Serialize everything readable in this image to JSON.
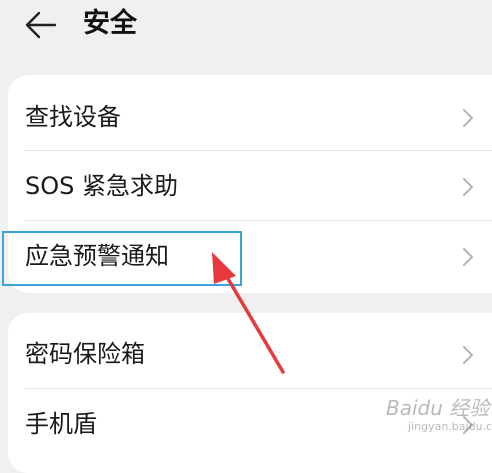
{
  "header": {
    "back_icon": "arrow-left-icon",
    "title": "安全"
  },
  "groups": [
    {
      "items": [
        {
          "label": "查找设备",
          "icon": "chevron-right-icon"
        },
        {
          "label": "SOS 紧急求助",
          "icon": "chevron-right-icon"
        },
        {
          "label": "应急预警通知",
          "icon": "chevron-right-icon"
        }
      ]
    },
    {
      "items": [
        {
          "label": "密码保险箱",
          "icon": "chevron-right-icon"
        },
        {
          "label": "手机盾",
          "icon": "chevron-right-icon"
        }
      ]
    }
  ],
  "annotation": {
    "highlight_color": "#3aa3d8",
    "arrow_color": "#e8383d"
  },
  "watermark": {
    "text": "Baidu 经验",
    "sub": "jingyan.baidu.com"
  },
  "colors": {
    "background": "#f0f0f0",
    "card": "#ffffff",
    "chevron": "#b5b5b5"
  }
}
